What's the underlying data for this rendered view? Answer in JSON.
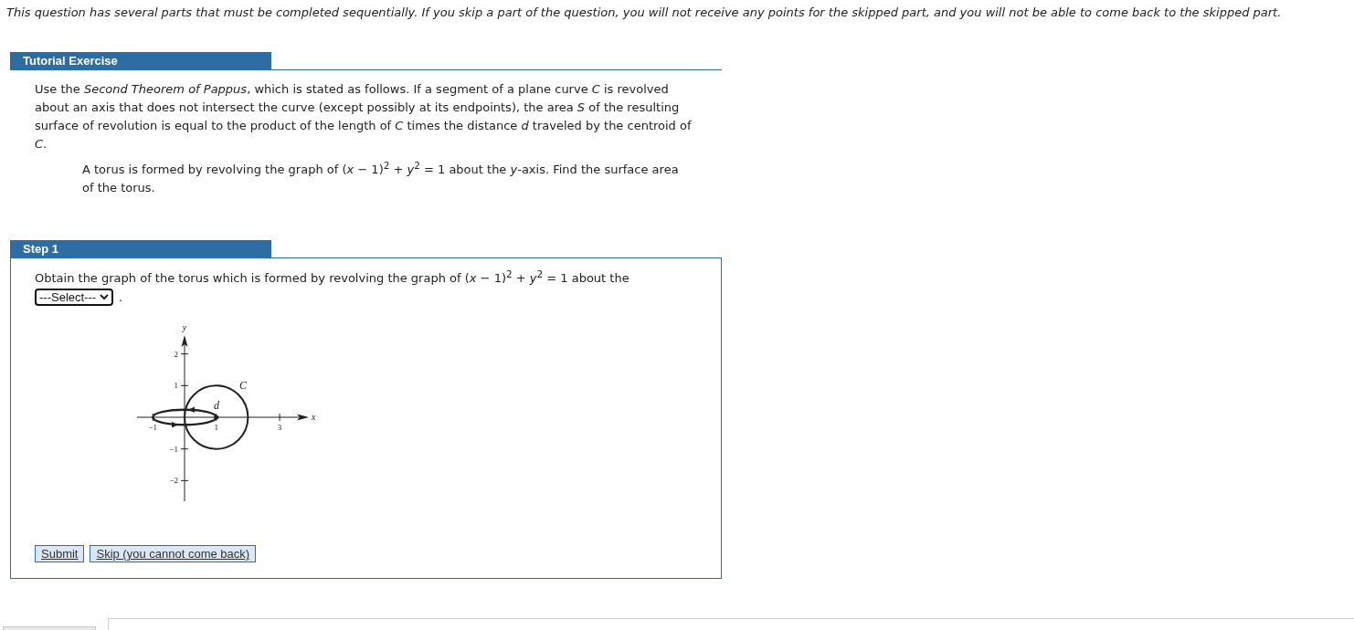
{
  "notice": "This question has several parts that must be completed sequentially. If you skip a part of the question, you will not receive any points for the skipped part, and you will not be able to come back to the skipped part.",
  "tutorial": {
    "title": "Tutorial Exercise",
    "intro": "Use the *Second Theorem of Pappus*, which is stated as follows. If a segment of a plane curve *C* is revolved about an axis that does not intersect the curve (except possibly at its endpoints), the area *S* of the resulting surface of revolution is equal to the product of the length of *C* times the distance *d* traveled by the centroid of *C*.",
    "problem": "A torus is formed by revolving the graph of (*x* − 1)$^{2}$ + *y*$^{2}$ = 1 about the *y*-axis. Find the surface area of the torus."
  },
  "step": {
    "title": "Step 1",
    "prompt": "Obtain the graph of the torus which is formed by revolving the graph of (*x* − 1)$^{2}$ + *y*$^{2}$ = 1 about the",
    "select": {
      "value": "---Select---"
    },
    "suffix": ".",
    "figure": {
      "x_label": "x",
      "y_label": "y",
      "x_tick_labels": [
        "−1",
        "1",
        "3"
      ],
      "y_tick_labels": [
        "2",
        "1",
        "−1",
        "−2"
      ],
      "curve_label": "C",
      "path_label": "d"
    },
    "buttons": [
      "Submit",
      "Skip (you cannot come back)"
    ]
  }
}
